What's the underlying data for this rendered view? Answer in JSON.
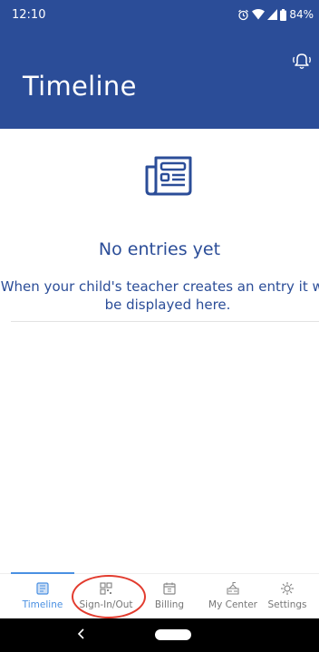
{
  "status_bar": {
    "time": "12:10",
    "battery": "84%"
  },
  "header": {
    "title": "Timeline"
  },
  "empty_state": {
    "title": "No entries yet",
    "description": "When your child's teacher creates an entry it will be displayed here."
  },
  "bottom_nav": {
    "items": [
      {
        "label": "Timeline",
        "icon": "newspaper-icon",
        "active": true
      },
      {
        "label": "Sign-In/Out",
        "icon": "qr-code-icon",
        "active": false
      },
      {
        "label": "Billing",
        "icon": "calendar-icon",
        "active": false
      },
      {
        "label": "My Center",
        "icon": "school-building-icon",
        "active": false
      },
      {
        "label": "Settings",
        "icon": "gear-icon",
        "active": false
      }
    ]
  },
  "colors": {
    "primary": "#2b4d98",
    "active_tab": "#4a90e2",
    "inactive_tab": "#777777",
    "annotation": "#e23b2e"
  }
}
